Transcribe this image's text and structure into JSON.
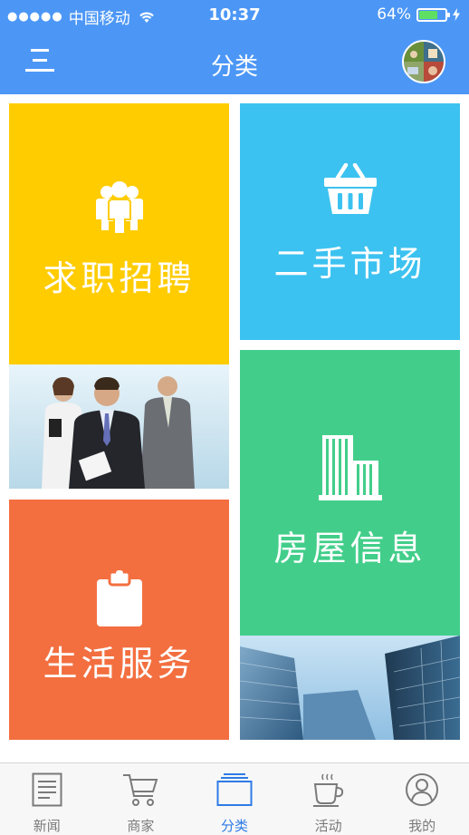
{
  "status_bar": {
    "signal_dots": "●●●●●",
    "carrier": "中国移动",
    "time": "10:37",
    "battery_percent": "64%"
  },
  "nav": {
    "title": "分类"
  },
  "tiles": {
    "jobs": {
      "label": "求职招聘",
      "color": "#ffcc00",
      "icon": "people-icon"
    },
    "market": {
      "label": "二手市场",
      "color": "#3cc2f0",
      "icon": "basket-icon"
    },
    "housing": {
      "label": "房屋信息",
      "color": "#42ce8a",
      "icon": "building-icon"
    },
    "life": {
      "label": "生活服务",
      "color": "#f36f40",
      "icon": "clipboard-icon"
    }
  },
  "tabbar": {
    "items": [
      {
        "label": "新闻",
        "icon": "newspaper-icon"
      },
      {
        "label": "商家",
        "icon": "cart-icon"
      },
      {
        "label": "分类",
        "icon": "category-icon",
        "active": true
      },
      {
        "label": "活动",
        "icon": "coffee-icon"
      },
      {
        "label": "我的",
        "icon": "user-icon"
      }
    ]
  },
  "colors": {
    "header": "#4c97f6",
    "tab_active": "#2e7be6",
    "tab_inactive": "#7a7a7a"
  }
}
